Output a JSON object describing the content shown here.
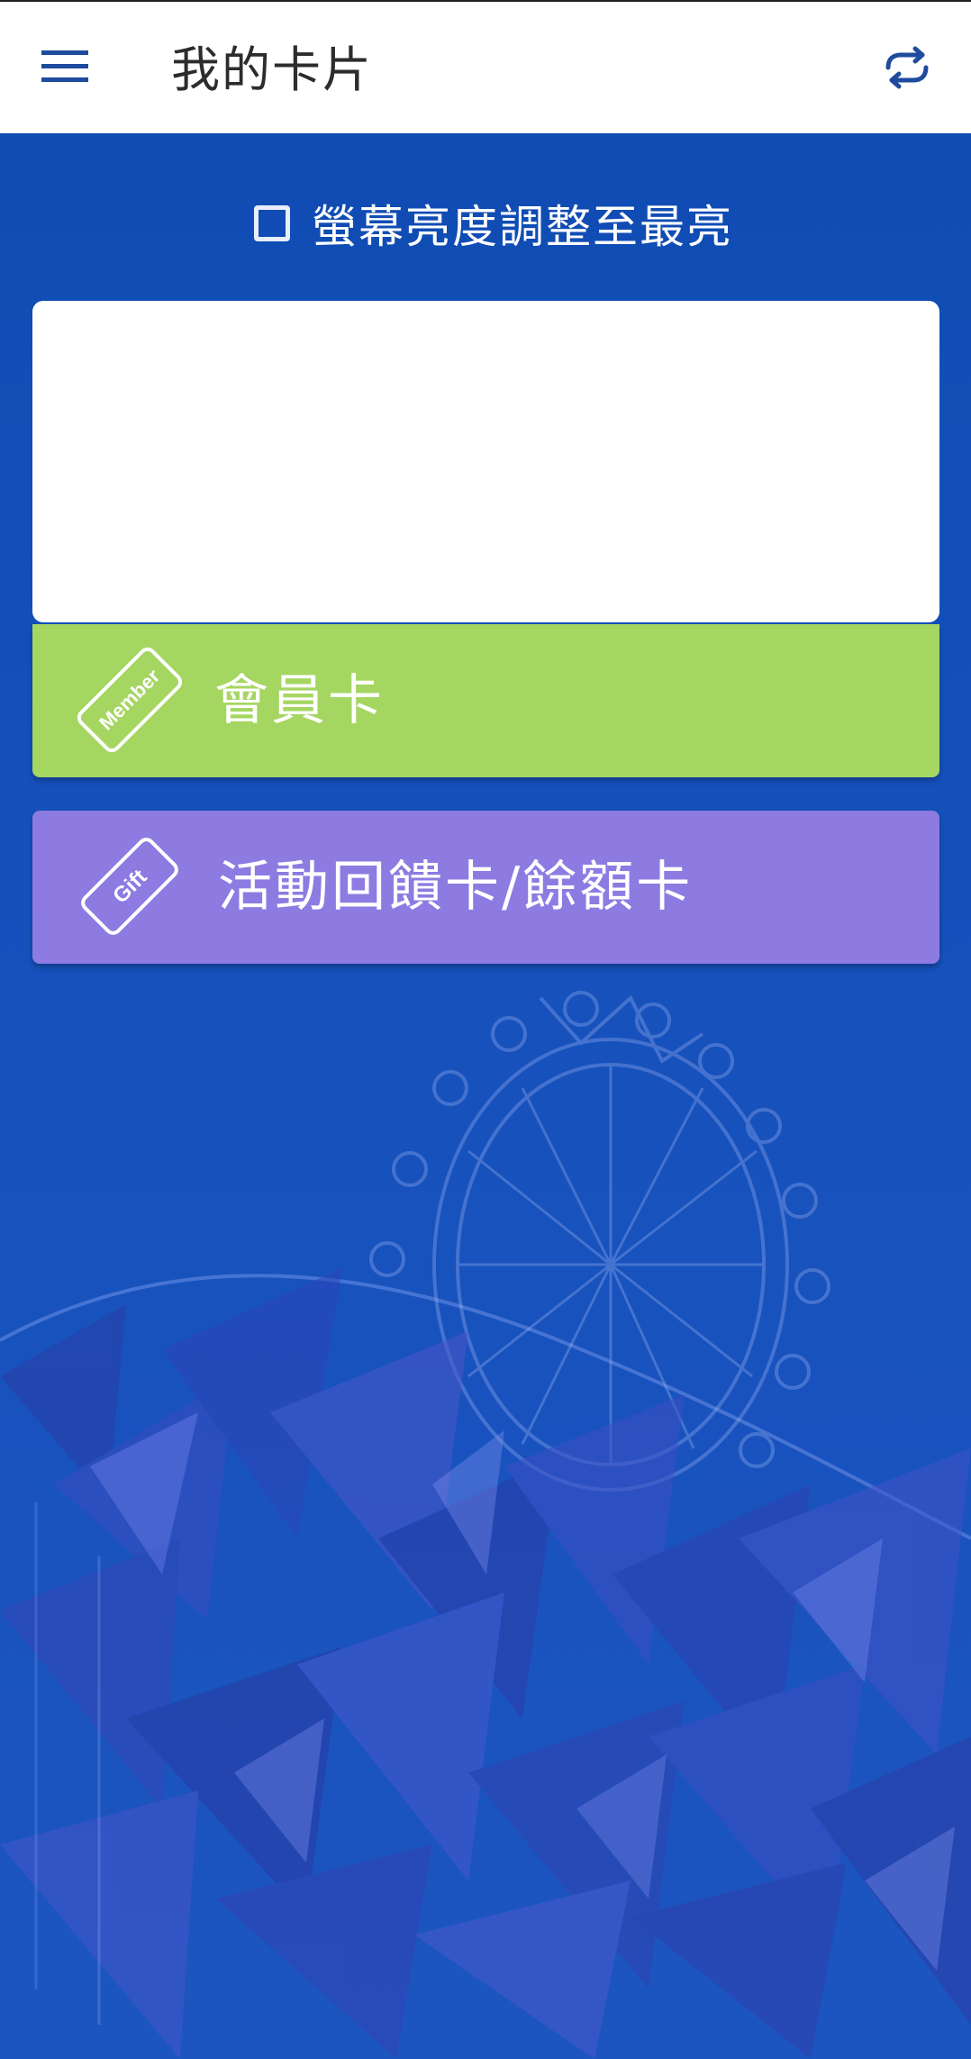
{
  "app_bar": {
    "title": "我的卡片",
    "menu_icon": "hamburger-menu-icon",
    "refresh_icon": "refresh-icon"
  },
  "brightness": {
    "label": "螢幕亮度調整至最亮",
    "checked": false
  },
  "cards": {
    "member": {
      "label": "會員卡",
      "tag_text": "Member",
      "color": "#a5d662"
    },
    "gift": {
      "label": "活動回饋卡/餘額卡",
      "tag_text": "Gift",
      "color": "#8d7be2"
    }
  },
  "colors": {
    "primary": "#1747b0",
    "app_bar": "#ffffff",
    "icon_blue": "#1f4b9e"
  }
}
